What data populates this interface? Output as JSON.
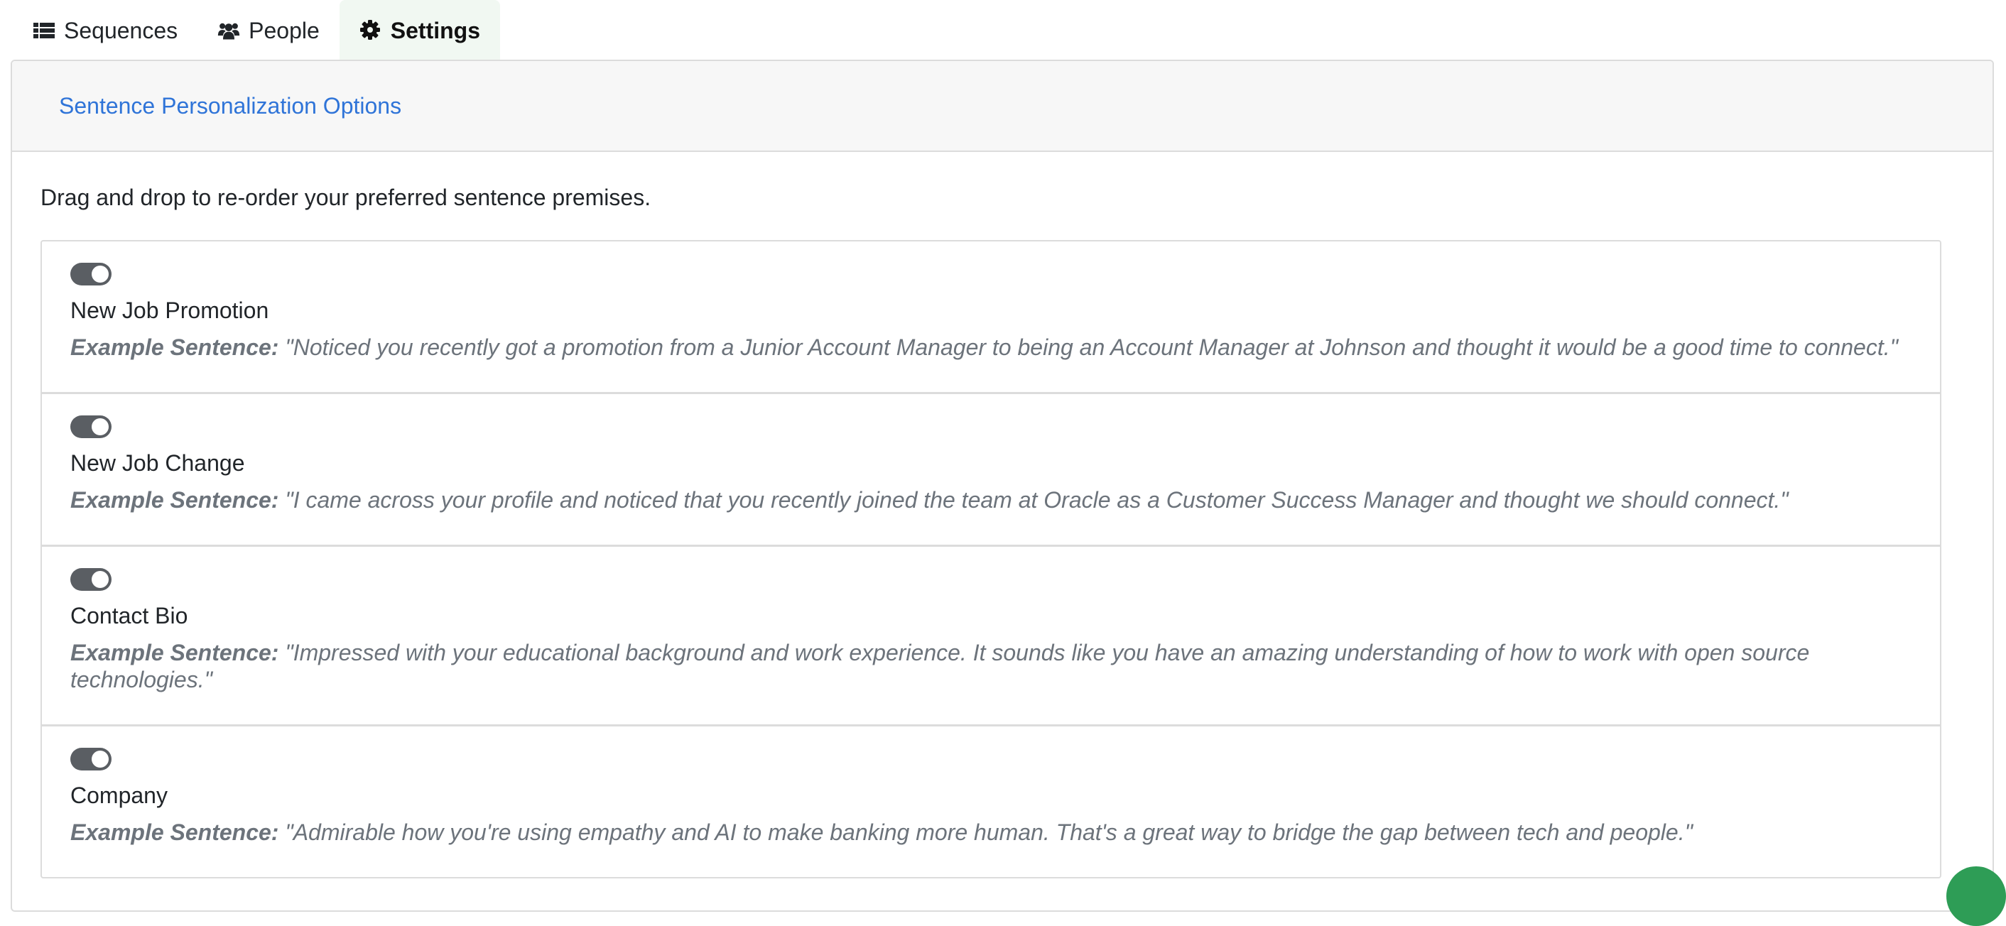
{
  "nav": {
    "tabs": [
      {
        "label": "Sequences",
        "icon": "list-icon"
      },
      {
        "label": "People",
        "icon": "users-icon"
      },
      {
        "label": "Settings",
        "icon": "gear-icon"
      }
    ],
    "active_tab": "Settings"
  },
  "card": {
    "header_link": "Sentence Personalization Options",
    "intro": "Drag and drop to re-order your preferred sentence premises."
  },
  "example_label": "Example Sentence:",
  "premises": [
    {
      "title": "New Job Promotion",
      "enabled": true,
      "example": "\"Noticed you recently got a promotion from a Junior Account Manager to being an Account Manager at Johnson and thought it would be a good time to connect.\""
    },
    {
      "title": "New Job Change",
      "enabled": true,
      "example": "\"I came across your profile and noticed that you recently joined the team at Oracle as a Customer Success Manager and thought we should connect.\""
    },
    {
      "title": "Contact Bio",
      "enabled": true,
      "example": "\"Impressed with your educational background and work experience. It sounds like you have an amazing understanding of how to work with open source technologies.\""
    },
    {
      "title": "Company",
      "enabled": true,
      "example": "\"Admirable how you're using empathy and AI to make banking more human. That's a great way to bridge the gap between tech and people.\""
    }
  ],
  "colors": {
    "link": "#2f74d8",
    "toggle": "#5a5e63",
    "example_text": "#6c737b",
    "active_tab_bg": "#f1f8f2",
    "fab": "#2e9d56"
  }
}
